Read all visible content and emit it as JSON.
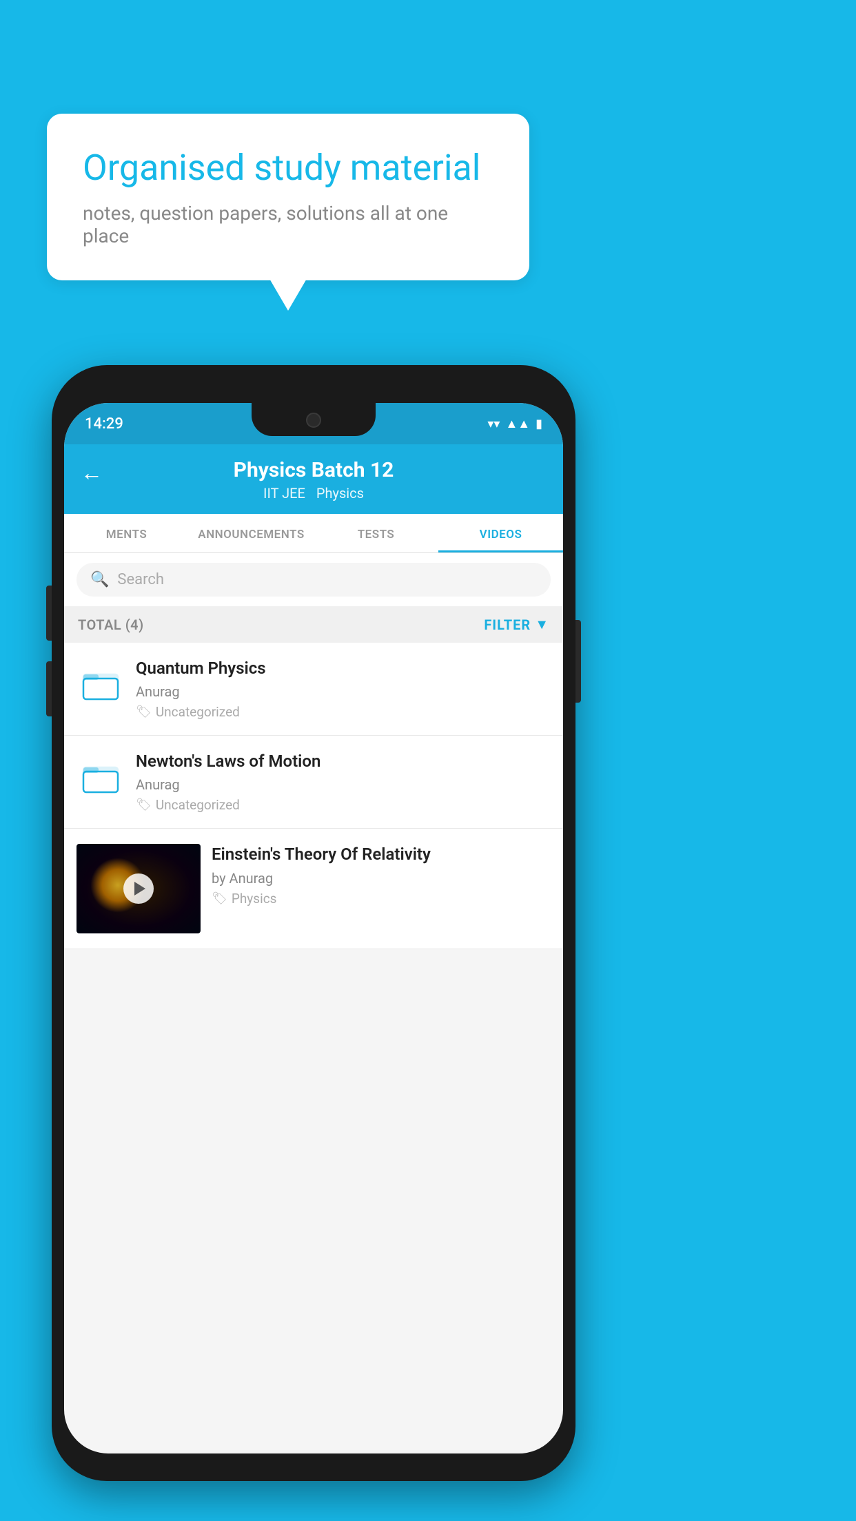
{
  "bubble": {
    "title": "Organised study material",
    "subtitle": "notes, question papers, solutions all at one place"
  },
  "status": {
    "time": "14:29"
  },
  "header": {
    "back_label": "←",
    "title": "Physics Batch 12",
    "tag1": "IIT JEE",
    "tag2": "Physics"
  },
  "tabs": [
    {
      "label": "MENTS",
      "active": false
    },
    {
      "label": "ANNOUNCEMENTS",
      "active": false
    },
    {
      "label": "TESTS",
      "active": false
    },
    {
      "label": "VIDEOS",
      "active": true
    }
  ],
  "search": {
    "placeholder": "Search"
  },
  "filter": {
    "total_label": "TOTAL (4)",
    "filter_label": "FILTER"
  },
  "videos": [
    {
      "id": "quantum",
      "title": "Quantum Physics",
      "author": "Anurag",
      "tag": "Uncategorized",
      "type": "folder"
    },
    {
      "id": "newton",
      "title": "Newton's Laws of Motion",
      "author": "Anurag",
      "tag": "Uncategorized",
      "type": "folder"
    },
    {
      "id": "einstein",
      "title": "Einstein's Theory Of Relativity",
      "author": "by Anurag",
      "tag": "Physics",
      "type": "video"
    }
  ]
}
